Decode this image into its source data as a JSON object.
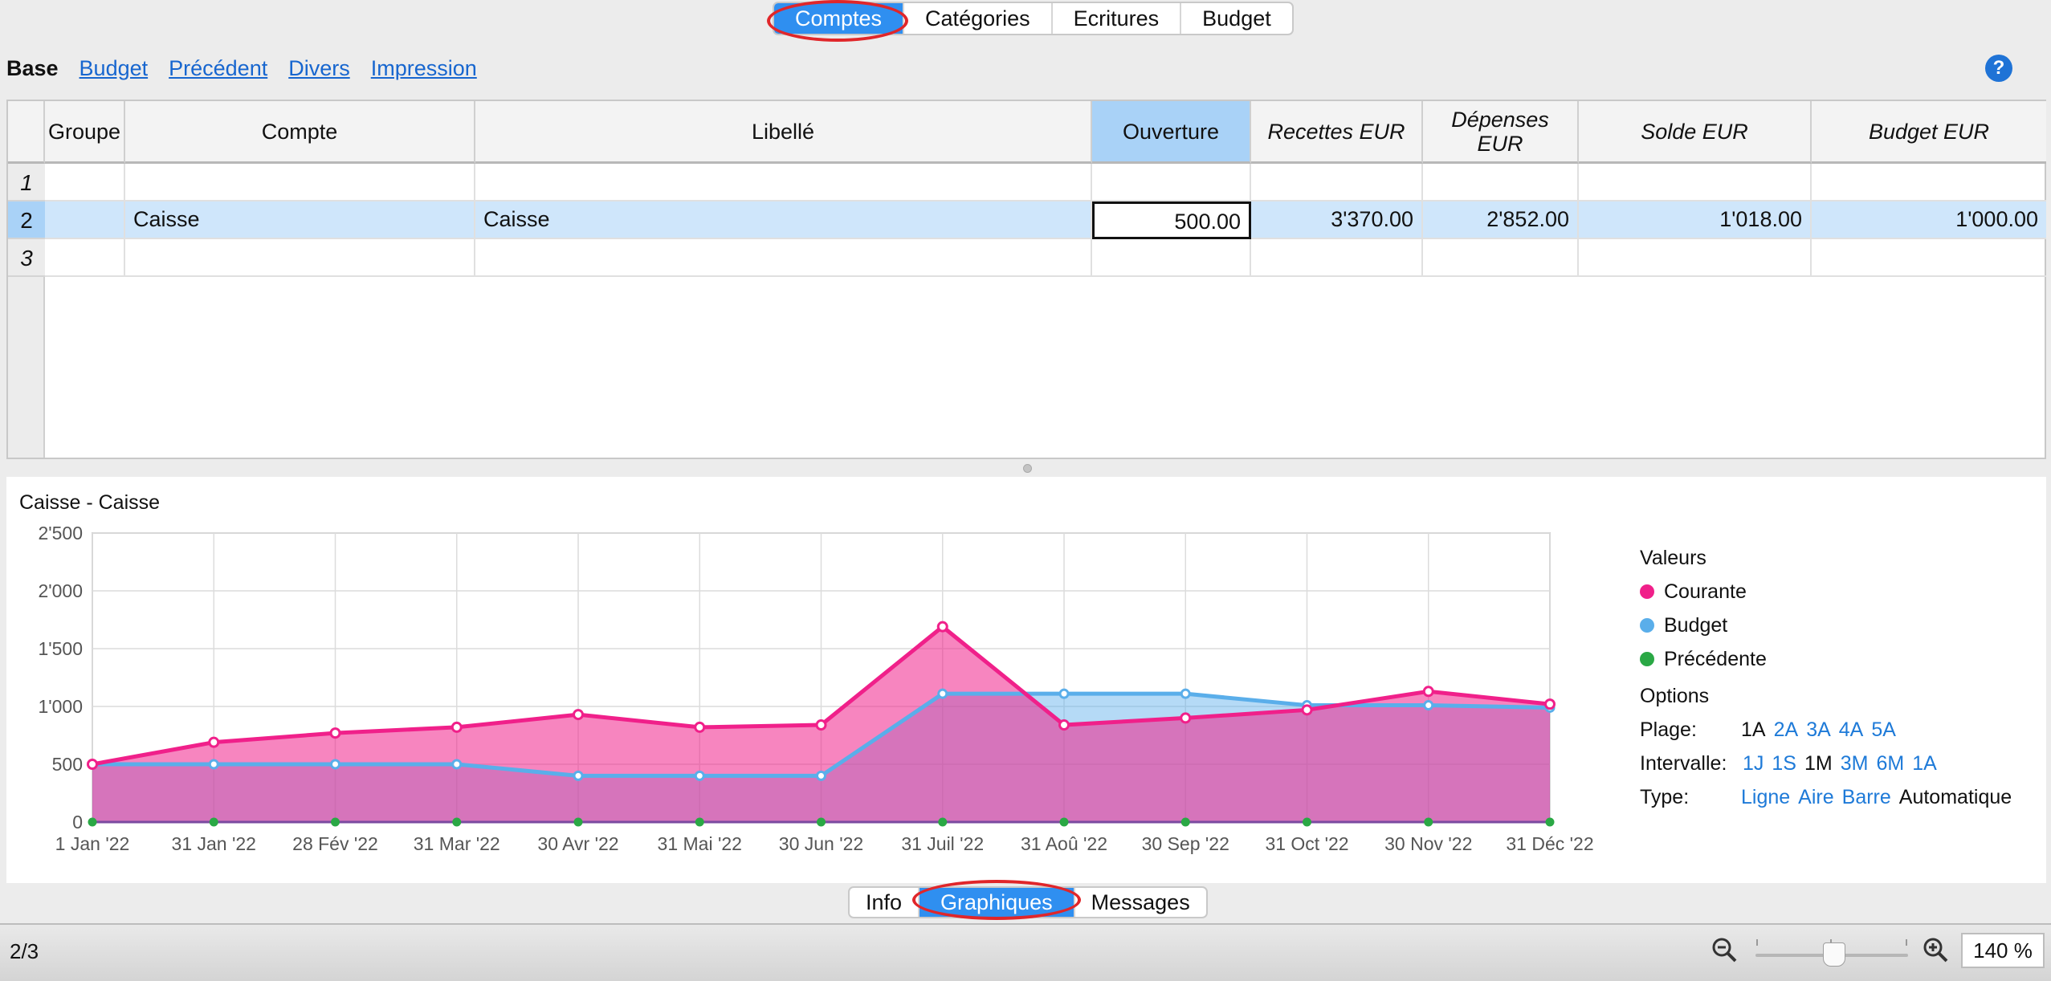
{
  "top_tabs": [
    "Comptes",
    "Catégories",
    "Ecritures",
    "Budget"
  ],
  "subnav": {
    "current": "Base",
    "links": [
      "Budget",
      "Précédent",
      "Divers",
      "Impression"
    ]
  },
  "help_icon": "?",
  "table": {
    "columns": [
      "Groupe",
      "Compte",
      "Libellé",
      "Ouverture",
      "Recettes EUR",
      "Dépenses EUR",
      "Solde EUR",
      "Budget EUR"
    ],
    "row_numbers": [
      "1",
      "2",
      "3"
    ],
    "rows": [
      {
        "groupe": "",
        "compte": "",
        "libelle": "",
        "ouverture": "",
        "recettes": "",
        "depenses": "",
        "solde": "",
        "budget": ""
      },
      {
        "groupe": "",
        "compte": "Caisse",
        "libelle": "Caisse",
        "ouverture": "500.00",
        "recettes": "3'370.00",
        "depenses": "2'852.00",
        "solde": "1'018.00",
        "budget": "1'000.00"
      },
      {
        "groupe": "",
        "compte": "",
        "libelle": "",
        "ouverture": "",
        "recettes": "",
        "depenses": "",
        "solde": "",
        "budget": ""
      }
    ]
  },
  "chart_title": "Caisse - Caisse",
  "chart_data": {
    "type": "area",
    "x": [
      "1 Jan '22",
      "31 Jan '22",
      "28 Fév '22",
      "31 Mar '22",
      "30 Avr '22",
      "31 Mai '22",
      "30 Jun '22",
      "31 Juil '22",
      "31 Aoû '22",
      "30 Sep '22",
      "31 Oct '22",
      "30 Nov '22",
      "31 Déc '22"
    ],
    "y_ticks": [
      "0",
      "500",
      "1'000",
      "1'500",
      "2'000",
      "2'500"
    ],
    "ylim": [
      0,
      2500
    ],
    "grid": true,
    "legend_position": "right",
    "series": [
      {
        "name": "Courante",
        "color": "#f0208a",
        "values": [
          500,
          690,
          770,
          820,
          930,
          820,
          840,
          1690,
          840,
          900,
          970,
          1130,
          1020
        ]
      },
      {
        "name": "Budget",
        "color": "#5aaeea",
        "values": [
          500,
          500,
          500,
          500,
          400,
          400,
          400,
          1110,
          1110,
          1110,
          1010,
          1010,
          990
        ]
      },
      {
        "name": "Précédente",
        "color": "#2aa845",
        "values": [
          0,
          0,
          0,
          0,
          0,
          0,
          0,
          0,
          0,
          0,
          0,
          0,
          0
        ]
      }
    ]
  },
  "legend": {
    "values_title": "Valeurs",
    "options_title": "Options",
    "plage_label": "Plage:",
    "plage_options": [
      "1A",
      "2A",
      "3A",
      "4A",
      "5A"
    ],
    "intervalle_label": "Intervalle:",
    "intervalle_options": [
      "1J",
      "1S",
      "1M",
      "3M",
      "6M",
      "1A"
    ],
    "type_label": "Type:",
    "type_options": [
      "Ligne",
      "Aire",
      "Barre",
      "Automatique"
    ]
  },
  "bottom_tabs": [
    "Info",
    "Graphiques",
    "Messages"
  ],
  "status": {
    "page": "2/3",
    "zoom": "140 %"
  }
}
